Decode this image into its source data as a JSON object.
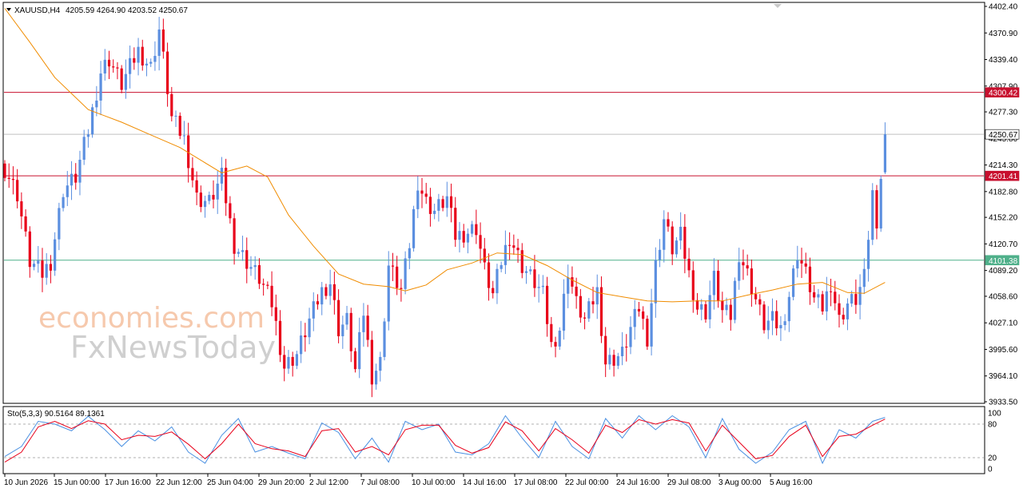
{
  "header": {
    "symbol": "XAUUSD,H4",
    "ohlc": "4205.59 4264.90 4203.52 4250.67",
    "stoch_label": "Sto(5,3,3) 90.5164 89.1361"
  },
  "watermark": {
    "line1": "economies.com",
    "line2": "FxNewsToday"
  },
  "colors": {
    "bull": "#5b8fe0",
    "bear": "#e8001a",
    "ma": "#f08c00",
    "resistance": "#c8102e",
    "support": "#4fb08a",
    "price_line": "#c0c0c0",
    "stoch_main": "#4a90e2",
    "stoch_signal": "#e8001a"
  },
  "chart_data": [
    {
      "type": "candlestick",
      "title": "XAUUSD,H4",
      "ylim": [
        3933.5,
        4402.4
      ],
      "y_ticks": [
        4402.4,
        4370.9,
        4339.4,
        4307.9,
        4277.3,
        4245.8,
        4214.3,
        4182.8,
        4152.2,
        4120.7,
        4089.2,
        4058.6,
        4027.1,
        3995.6,
        3964.1,
        3933.5
      ],
      "x_ticks": [
        "10 Jun 2026",
        "15 Jun 00:00",
        "17 Jun 16:00",
        "22 Jun 12:00",
        "25 Jun 04:00",
        "29 Jun 20:00",
        "2 Jul 12:00",
        "7 Jul 08:00",
        "10 Jul 00:00",
        "14 Jul 16:00",
        "17 Jul 08:00",
        "22 Jul 00:00",
        "24 Jul 16:00",
        "29 Jul 08:00",
        "3 Aug 00:00",
        "5 Aug 16:00"
      ],
      "horizontal_lines": [
        {
          "label": "4300.42",
          "value": 4300.42,
          "role": "resistance"
        },
        {
          "label": "4250.67",
          "value": 4250.67,
          "role": "current"
        },
        {
          "label": "4201.41",
          "value": 4201.41,
          "role": "resistance"
        },
        {
          "label": "4101.38",
          "value": 4101.38,
          "role": "support"
        }
      ],
      "close_path": [
        [
          0,
          4210
        ],
        [
          3,
          4180
        ],
        [
          6,
          4100
        ],
        [
          9,
          4085
        ],
        [
          11,
          4100
        ],
        [
          14,
          4185
        ],
        [
          17,
          4200
        ],
        [
          20,
          4255
        ],
        [
          23,
          4325
        ],
        [
          25,
          4340
        ],
        [
          28,
          4310
        ],
        [
          32,
          4350
        ],
        [
          35,
          4330
        ],
        [
          37,
          4375
        ],
        [
          40,
          4270
        ],
        [
          43,
          4245
        ],
        [
          46,
          4175
        ],
        [
          49,
          4170
        ],
        [
          52,
          4200
        ],
        [
          55,
          4120
        ],
        [
          58,
          4100
        ],
        [
          61,
          4080
        ],
        [
          64,
          4050
        ],
        [
          67,
          3975
        ],
        [
          70,
          3990
        ],
        [
          73,
          4030
        ],
        [
          76,
          4065
        ],
        [
          78,
          4075
        ],
        [
          80,
          4020
        ],
        [
          82,
          4030
        ],
        [
          84,
          3970
        ],
        [
          86,
          4040
        ],
        [
          88,
          3965
        ],
        [
          90,
          3980
        ],
        [
          92,
          4095
        ],
        [
          95,
          4065
        ],
        [
          97,
          4120
        ],
        [
          99,
          4195
        ],
        [
          101,
          4170
        ],
        [
          103,
          4160
        ],
        [
          106,
          4175
        ],
        [
          108,
          4130
        ],
        [
          111,
          4135
        ],
        [
          113,
          4140
        ],
        [
          115,
          4090
        ],
        [
          117,
          4060
        ],
        [
          119,
          4100
        ],
        [
          121,
          4130
        ],
        [
          124,
          4095
        ],
        [
          127,
          4075
        ],
        [
          129,
          4060
        ],
        [
          131,
          4000
        ],
        [
          133,
          4020
        ],
        [
          135,
          4090
        ],
        [
          137,
          4050
        ],
        [
          139,
          4030
        ],
        [
          142,
          4065
        ],
        [
          144,
          3980
        ],
        [
          146,
          3985
        ],
        [
          148,
          3990
        ],
        [
          150,
          4020
        ],
        [
          152,
          4045
        ],
        [
          154,
          4010
        ],
        [
          156,
          4095
        ],
        [
          158,
          4150
        ],
        [
          160,
          4115
        ],
        [
          162,
          4130
        ],
        [
          164,
          4085
        ],
        [
          166,
          4045
        ],
        [
          168,
          4040
        ],
        [
          170,
          4080
        ],
        [
          172,
          4040
        ],
        [
          174,
          4035
        ],
        [
          176,
          4110
        ],
        [
          178,
          4085
        ],
        [
          180,
          4055
        ],
        [
          182,
          4025
        ],
        [
          184,
          4030
        ],
        [
          186,
          4020
        ],
        [
          188,
          4060
        ],
        [
          190,
          4110
        ],
        [
          192,
          4085
        ],
        [
          194,
          4055
        ],
        [
          196,
          4045
        ],
        [
          198,
          4075
        ],
        [
          200,
          4030
        ],
        [
          202,
          4050
        ],
        [
          204,
          4055
        ],
        [
          206,
          4080
        ],
        [
          208,
          4180
        ],
        [
          209,
          4150
        ],
        [
          210,
          4200
        ],
        [
          211,
          4250.67
        ]
      ],
      "ma_path": [
        [
          0,
          4400
        ],
        [
          6,
          4360
        ],
        [
          12,
          4318
        ],
        [
          20,
          4280
        ],
        [
          28,
          4265
        ],
        [
          35,
          4250
        ],
        [
          42,
          4235
        ],
        [
          47,
          4220
        ],
        [
          52,
          4205
        ],
        [
          58,
          4213
        ],
        [
          63,
          4200
        ],
        [
          68,
          4155
        ],
        [
          74,
          4118
        ],
        [
          80,
          4085
        ],
        [
          86,
          4073
        ],
        [
          92,
          4070
        ],
        [
          96,
          4065
        ],
        [
          101,
          4072
        ],
        [
          106,
          4090
        ],
        [
          112,
          4098
        ],
        [
          118,
          4110
        ],
        [
          124,
          4108
        ],
        [
          130,
          4095
        ],
        [
          136,
          4078
        ],
        [
          142,
          4063
        ],
        [
          148,
          4058
        ],
        [
          154,
          4053
        ],
        [
          160,
          4052
        ],
        [
          166,
          4053
        ],
        [
          172,
          4053
        ],
        [
          178,
          4060
        ],
        [
          184,
          4066
        ],
        [
          190,
          4073
        ],
        [
          196,
          4075
        ],
        [
          202,
          4063
        ],
        [
          206,
          4062
        ],
        [
          211,
          4075
        ]
      ]
    },
    {
      "type": "line",
      "title": "Sto(5,3,3) 90.5164 89.1361",
      "ylim": [
        0,
        100
      ],
      "y_ticks": [
        100,
        80,
        20,
        0
      ],
      "levels": [
        80,
        20
      ],
      "series": [
        {
          "points": [
            [
              0,
              22
            ],
            [
              4,
              40
            ],
            [
              8,
              85
            ],
            [
              12,
              80
            ],
            [
              16,
              68
            ],
            [
              20,
              94
            ],
            [
              24,
              70
            ],
            [
              28,
              40
            ],
            [
              32,
              68
            ],
            [
              36,
              50
            ],
            [
              40,
              75
            ],
            [
              44,
              30
            ],
            [
              48,
              10
            ],
            [
              52,
              60
            ],
            [
              56,
              90
            ],
            [
              60,
              30
            ],
            [
              64,
              40
            ],
            [
              68,
              28
            ],
            [
              72,
              18
            ],
            [
              76,
              82
            ],
            [
              80,
              65
            ],
            [
              84,
              18
            ],
            [
              88,
              55
            ],
            [
              92,
              12
            ],
            [
              96,
              85
            ],
            [
              100,
              70
            ],
            [
              104,
              80
            ],
            [
              108,
              30
            ],
            [
              112,
              25
            ],
            [
              116,
              45
            ],
            [
              120,
              95
            ],
            [
              124,
              55
            ],
            [
              128,
              20
            ],
            [
              132,
              85
            ],
            [
              136,
              40
            ],
            [
              140,
              18
            ],
            [
              144,
              90
            ],
            [
              148,
              55
            ],
            [
              152,
              95
            ],
            [
              156,
              70
            ],
            [
              160,
              95
            ],
            [
              164,
              75
            ],
            [
              168,
              20
            ],
            [
              172,
              90
            ],
            [
              176,
              35
            ],
            [
              180,
              10
            ],
            [
              184,
              30
            ],
            [
              188,
              70
            ],
            [
              192,
              85
            ],
            [
              196,
              10
            ],
            [
              200,
              70
            ],
            [
              204,
              55
            ],
            [
              208,
              85
            ],
            [
              211,
              92
            ]
          ]
        },
        {
          "points": [
            [
              0,
              12
            ],
            [
              4,
              30
            ],
            [
              8,
              75
            ],
            [
              12,
              85
            ],
            [
              16,
              72
            ],
            [
              20,
              86
            ],
            [
              24,
              80
            ],
            [
              28,
              52
            ],
            [
              32,
              60
            ],
            [
              36,
              58
            ],
            [
              40,
              66
            ],
            [
              44,
              44
            ],
            [
              48,
              18
            ],
            [
              52,
              45
            ],
            [
              56,
              80
            ],
            [
              60,
              45
            ],
            [
              64,
              36
            ],
            [
              68,
              32
            ],
            [
              72,
              22
            ],
            [
              76,
              68
            ],
            [
              80,
              72
            ],
            [
              84,
              30
            ],
            [
              88,
              40
            ],
            [
              92,
              25
            ],
            [
              96,
              70
            ],
            [
              100,
              78
            ],
            [
              104,
              78
            ],
            [
              108,
              42
            ],
            [
              112,
              28
            ],
            [
              116,
              38
            ],
            [
              120,
              84
            ],
            [
              124,
              68
            ],
            [
              128,
              32
            ],
            [
              132,
              72
            ],
            [
              136,
              52
            ],
            [
              140,
              28
            ],
            [
              144,
              78
            ],
            [
              148,
              65
            ],
            [
              152,
              88
            ],
            [
              156,
              80
            ],
            [
              160,
              88
            ],
            [
              164,
              82
            ],
            [
              168,
              32
            ],
            [
              172,
              78
            ],
            [
              176,
              48
            ],
            [
              180,
              18
            ],
            [
              184,
              24
            ],
            [
              188,
              58
            ],
            [
              192,
              78
            ],
            [
              196,
              22
            ],
            [
              200,
              58
            ],
            [
              204,
              62
            ],
            [
              208,
              78
            ],
            [
              211,
              89
            ]
          ]
        }
      ]
    }
  ]
}
